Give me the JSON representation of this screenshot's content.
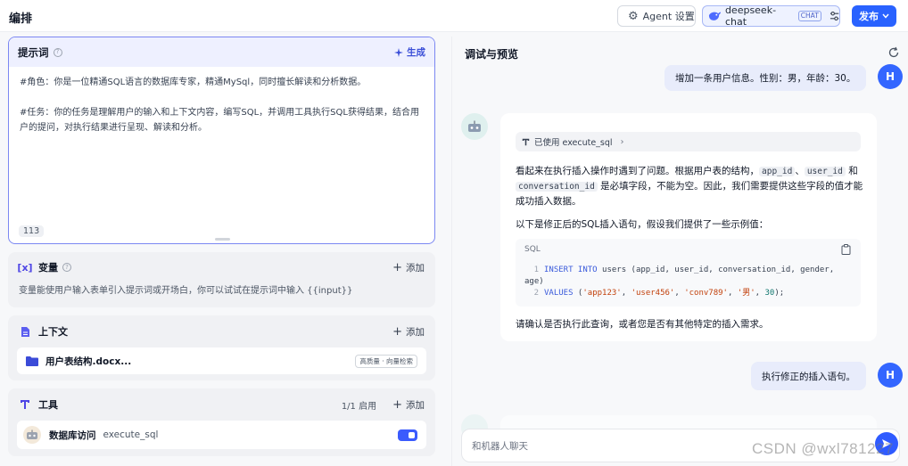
{
  "header": {
    "title": "编排",
    "agent_settings": "Agent 设置",
    "model_name": "deepseek-chat",
    "model_tag": "CHAT",
    "publish": "发布"
  },
  "prompt": {
    "title": "提示词",
    "generate": "生成",
    "line1": "#角色：你是一位精通SQL语言的数据库专家，精通MySql，同时擅长解读和分析数据。",
    "line2": "#任务：你的任务是理解用户的输入和上下文内容，编写SQL，并调用工具执行SQL获得结果，结合用户的提问，对执行结果进行呈现、解读和分析。",
    "char_count": "113"
  },
  "variables": {
    "title": "变量",
    "add": "添加",
    "hint": "变量能使用户输入表单引入提示词或开场白，你可以试试在提示词中输入 {{input}}"
  },
  "context": {
    "title": "上下文",
    "add": "添加",
    "item_name": "用户表结构.docx...",
    "item_badge": "高质量 · 向量检索"
  },
  "tools": {
    "title": "工具",
    "enabled_count": "1/1 启用",
    "add": "添加",
    "item_name": "数据库访问",
    "item_fn": "execute_sql"
  },
  "preview": {
    "title": "调试与预览",
    "user_msg1": "增加一条用户信息。性别：男，年龄：30。",
    "user_avatar": "H",
    "tool_used": "已使用 execute_sql",
    "bot_p1_a": "看起来在执行插入操作时遇到了问题。根据用户表的结构，",
    "code1": "app_id",
    "sep1": "、",
    "code2": "user_id",
    "sep2": " 和",
    "code3": "conversation_id",
    "bot_p1_b": " 是必填字段，不能为空。因此，我们需要提供这些字段的值才能成功插入数据。",
    "bot_p2": "以下是修正后的SQL插入语句，假设我们提供了一些示例值：",
    "code_lang": "SQL",
    "bot_p3": "请确认是否执行此查询，或者您是否有其他特定的插入需求。",
    "user_msg2": "执行修正的插入语句。",
    "input_placeholder": "和机器人聊天"
  },
  "watermark": "CSDN @wxl781227"
}
